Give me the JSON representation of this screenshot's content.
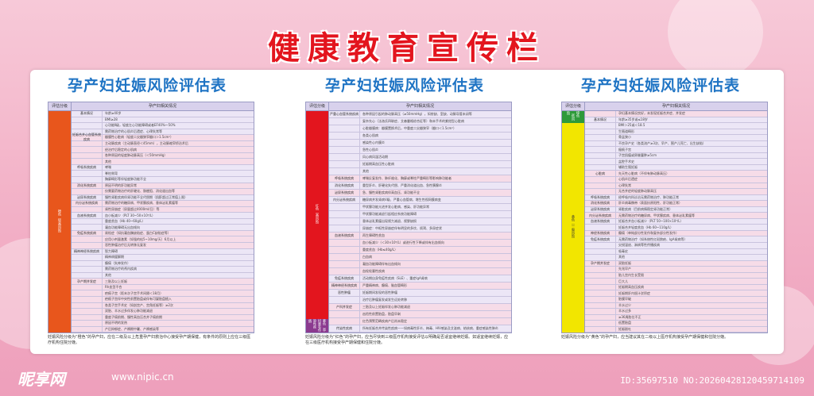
{
  "banner": {
    "title": "健康教育宣传栏"
  },
  "panels": [
    {
      "title": "孕产妇妊娠风险评估表",
      "head_level": "评估分级",
      "head_cond": "孕产妇相关情况",
      "level_labels": [
        "橙色（较高风险）"
      ],
      "level_color": "#e8561c",
      "rows": [
        {
          "cat": "基本情况",
          "text": "年龄≥40岁"
        },
        {
          "cat": "",
          "text": "BMI≥28"
        },
        {
          "cat": "",
          "text": "心功能Ⅱ级，轻度左心功能障碍或者EF40%～50%"
        },
        {
          "cat": "",
          "text": "需药物治疗的心肌炎后遗症、心律失常等"
        },
        {
          "cat": "妊娠合并心血管系统疾病",
          "text": "瓣膜性心脏病（轻度二尖瓣狭窄瓣口＞1.5cm²）"
        },
        {
          "cat": "",
          "text": "主动脉疾病（主动脉直径＜45mm），主动脉缩窄矫治术后"
        },
        {
          "cat": "",
          "text": "经治疗后稳定的心肌病"
        },
        {
          "cat": "",
          "text": "各种原因的轻度肺动脉高压（＜50mmHg）"
        },
        {
          "cat": "",
          "text": "其他"
        },
        {
          "cat": "呼吸系统疾病",
          "text": "哮喘"
        },
        {
          "cat": "",
          "text": "脊柱侧弯"
        },
        {
          "cat": "",
          "text": "胸廓畸形等伴轻度肺功能不全"
        },
        {
          "cat": "消化系统疾病",
          "text": "原因不明的肝功能异常"
        },
        {
          "cat": "",
          "text": "仅需要药物治疗的肝硬化、肠梗阻、消化道出血等"
        },
        {
          "cat": "泌尿系统疾病",
          "text": "慢性肾脏疾病伴肾功能不全代偿期（肌酐超过正常值上限）"
        },
        {
          "cat": "内分泌系统疾病",
          "text": "需药物治疗的糖尿病、甲状腺疾病、垂体泌乳素瘤等"
        },
        {
          "cat": "",
          "text": "肾性尿崩症（尿量超过4000ml/日）等"
        },
        {
          "cat": "血液系统疾病",
          "text": "血小板减少（PLT 30~50×10⁹/L）"
        },
        {
          "cat": "",
          "text": "重度贫血（Hb 40~60g/L）"
        },
        {
          "cat": "",
          "text": "凝血功能障碍无出血倾向"
        },
        {
          "cat": "免疫系统疾病",
          "text": "易栓症（如抗凝血酶缺陷症、蛋白C缺陷症等）"
        },
        {
          "cat": "",
          "text": "应用小剂量激素（如强的松5~10mg/天）6月以上"
        },
        {
          "cat": "",
          "text": "恶性肿瘤治疗后无转移无复发"
        },
        {
          "cat": "精神神经系统疾病",
          "text": "智力障碍"
        },
        {
          "cat": "",
          "text": "精神病缓解期"
        },
        {
          "cat": "",
          "text": "癫痫（失神发作）"
        },
        {
          "cat": "",
          "text": "需药物治疗的颅内疾病"
        },
        {
          "cat": "",
          "text": "其他"
        },
        {
          "cat": "孕产期并发症",
          "text": "三胎及以上妊娠"
        },
        {
          "cat": "",
          "text": "Rh血型不合"
        },
        {
          "cat": "",
          "text": "疤痕子宫（距末次子宫手术间隔＜18月）"
        },
        {
          "cat": "",
          "text": "疤痕子宫伴中央性前置胎盘或伴有可疑胎盘植入"
        },
        {
          "cat": "",
          "text": "各类子宫手术史（如剖宫产、宫角妊娠等）≥2次"
        },
        {
          "cat": "",
          "text": "双胎、羊水过多伴发心肺功能减退"
        },
        {
          "cat": "",
          "text": "重度子痫前期、慢性高血压合并子痫前期"
        },
        {
          "cat": "",
          "text": "原因不明的发热"
        },
        {
          "cat": "",
          "text": "产后抑郁症、产褥期中暑、产褥感染等"
        }
      ],
      "note": "妊娠风险分级为“橙色”的孕产妇，应在二级及以上危重孕产妇救治中心接受孕产期保健，有条件的原则上应在三级医疗机构住院分娩。"
    },
    {
      "title": "孕产妇妊娠风险评估表",
      "head_level": "评估分级",
      "head_cond": "孕产妇相关情况",
      "level_labels": [
        "红色（高风险）",
        "紫色（孕妇患有传染性疾病）"
      ],
      "level_color": "#e3151e",
      "rows": [
        {
          "cat": "严重心血管系统疾病",
          "text": "各种原因引起的肺动脉高压（≥50mmHg），如房缺、室缺、动脉导管未闭等"
        },
        {
          "cat": "",
          "text": "复杂先心（法洛氏四联症、艾森曼格综合征等）和未手术的紫绀型心脏病"
        },
        {
          "cat": "",
          "text": "心脏瓣膜病：瓣膜置换术后，中重度二尖瓣狭窄（瓣口＜1.5cm²）"
        },
        {
          "cat": "",
          "text": "各类心肌病"
        },
        {
          "cat": "",
          "text": "感染性心内膜炎"
        },
        {
          "cat": "",
          "text": "急性心肌炎"
        },
        {
          "cat": "",
          "text": "风心病风湿活动期"
        },
        {
          "cat": "",
          "text": "妊娠期高血压性心脏病"
        },
        {
          "cat": "",
          "text": "其他"
        },
        {
          "cat": "呼吸系统疾病",
          "text": "哮喘反复发作、肺纤维化、胸廓或脊柱严重畸形等影响肺功能者"
        },
        {
          "cat": "消化系统疾病",
          "text": "重型肝炎、肝硬化失代偿、严重消化道出血、急性胰腺炎"
        },
        {
          "cat": "泌尿系统疾病",
          "text": "急、慢性肾脏疾病伴高血压、肾功能不全"
        },
        {
          "cat": "内分泌系统疾病",
          "text": "糖尿病并发肾病V级、严重心血管病、增生性视网膜病变"
        },
        {
          "cat": "",
          "text": "甲状腺功能亢进并发心脏病、感染、肝功能异常"
        },
        {
          "cat": "",
          "text": "甲状腺功能减退引起相应系统功能障碍"
        },
        {
          "cat": "",
          "text": "垂体泌乳素瘤出现视力减退、视野缺损"
        },
        {
          "cat": "",
          "text": "尿崩症：中枢性尿崩症伴有明显的多饮、烦渴、多尿症状"
        },
        {
          "cat": "血液系统疾病",
          "text": "再生障碍性贫血"
        },
        {
          "cat": "",
          "text": "血小板减少（＜30×10⁹/L）或进行性下降或伴有出血倾向"
        },
        {
          "cat": "",
          "text": "重度贫血（Hb≤40g/L）"
        },
        {
          "cat": "",
          "text": "白血病"
        },
        {
          "cat": "",
          "text": "凝血功能障碍伴有出血倾向"
        },
        {
          "cat": "",
          "text": "血栓栓塞性疾病"
        },
        {
          "cat": "免疫系统疾病",
          "text": "活动期自身免疫性疾病（SLE）、重症IgA肾病"
        },
        {
          "cat": "精神神经系统疾病",
          "text": "严重精神病、癫痫、脑血管畸形"
        },
        {
          "cat": "恶性肿瘤",
          "text": "妊娠期间发现的恶性肿瘤"
        },
        {
          "cat": "",
          "text": "治疗后肿瘤复发或发生远处转移"
        },
        {
          "cat": "产科并发症",
          "text": "三胎及以上妊娠伴发心肺功能减退"
        },
        {
          "cat": "",
          "text": "凶险性前置胎盘，胎盘早剥"
        },
        {
          "cat": "",
          "text": "红色预警范畴疾病产后尚未稳定"
        },
        {
          "cat": "传染性疾病",
          "text": "所有妊娠合并传染性疾病——如病毒性肝炎、梅毒、HIV感染及艾滋病、结核病、重症感染性肺炎"
        }
      ],
      "note": "妊娠风险分级为“红色”的孕产妇，应当尽快到三级医疗机构接受评估以明确是否适宜继续妊娠。如适宜继续妊娠，应在三级医疗机构接受孕产期保健和住院分娩。"
    },
    {
      "title": "孕产妇妊娠风险评估表",
      "head_level": "评估分级",
      "head_cond": "孕产妇相关情况",
      "level_labels": [
        "绿色（低风险）",
        "黄色（一般风险）"
      ],
      "level_color": "#f2e600",
      "rows": [
        {
          "cat": "",
          "text": "孕妇基本情况良好，未发现妊娠合并症、并发症"
        },
        {
          "cat": "基本情况",
          "text": "年龄≥35岁或≤18岁"
        },
        {
          "cat": "",
          "text": "BMI＞25或＜18.5"
        },
        {
          "cat": "",
          "text": "生殖道畸形"
        },
        {
          "cat": "",
          "text": "骨盆狭小"
        },
        {
          "cat": "",
          "text": "不良孕产史（各类流产≥3次、早产、围产儿死亡、出生缺陷）"
        },
        {
          "cat": "",
          "text": "瘢痕子宫"
        },
        {
          "cat": "",
          "text": "子宫肌瘤或卵巢囊肿≥5cm"
        },
        {
          "cat": "",
          "text": "盆腔手术史"
        },
        {
          "cat": "",
          "text": "辅助生殖妊娠"
        },
        {
          "cat": "心脏病",
          "text": "先天性心脏病（不伴有肺动脉高压）"
        },
        {
          "cat": "",
          "text": "心肌炎后遗症"
        },
        {
          "cat": "",
          "text": "心律失常"
        },
        {
          "cat": "",
          "text": "无合并症的轻度肺动脉高压"
        },
        {
          "cat": "呼吸系统疾病",
          "text": "经呼吸内科诊治无需药物治疗、肺功能正常"
        },
        {
          "cat": "消化系统疾病",
          "text": "肝炎病毒携带（表面抗原阳性、肝功能正常）"
        },
        {
          "cat": "泌尿系统疾病",
          "text": "肾脏疾病（目前病情稳定肾功能正常）"
        },
        {
          "cat": "内分泌系统疾病",
          "text": "无需药物治疗的糖尿病、甲状腺疾病、垂体泌乳素瘤等"
        },
        {
          "cat": "血液系统疾病",
          "text": "妊娠合并血小板减少（PLT 50~100×10⁹/L）"
        },
        {
          "cat": "",
          "text": "妊娠合并轻度贫血（Hb 60~110g/L）"
        },
        {
          "cat": "神经系统疾病",
          "text": "癫痫（单纯部分性发作和复杂部分性发作）"
        },
        {
          "cat": "免疫系统疾病",
          "text": "无需药物治疗（如系统性红斑狼疮、IgA肾病等）"
        },
        {
          "cat": "",
          "text": "尖锐湿疣、淋病等性传播疾病"
        },
        {
          "cat": "",
          "text": "吸毒史"
        },
        {
          "cat": "",
          "text": "其他"
        },
        {
          "cat": "孕产期并发症",
          "text": "双胎妊娠"
        },
        {
          "cat": "",
          "text": "先兆早产"
        },
        {
          "cat": "",
          "text": "胎儿宫内生长受限"
        },
        {
          "cat": "",
          "text": "巨大儿"
        },
        {
          "cat": "",
          "text": "妊娠期高血压疾病"
        },
        {
          "cat": "",
          "text": "妊娠期肝内胆汁淤积症"
        },
        {
          "cat": "",
          "text": "胎膜早破"
        },
        {
          "cat": "",
          "text": "羊水过少"
        },
        {
          "cat": "",
          "text": "羊水过多"
        },
        {
          "cat": "",
          "text": "≥36周胎位不正"
        },
        {
          "cat": "",
          "text": "低置胎盘"
        },
        {
          "cat": "",
          "text": "妊娠剧吐"
        }
      ],
      "note": "妊娠风险分级为“黄色”的孕产妇，应当建议其在二级以上医疗机构接受孕产期保健和住院分娩。"
    }
  ],
  "footer": {
    "logo": "昵享网",
    "url": "www.nipic.cn",
    "id_text": "ID:35697510 NO:20260428120459714109"
  }
}
